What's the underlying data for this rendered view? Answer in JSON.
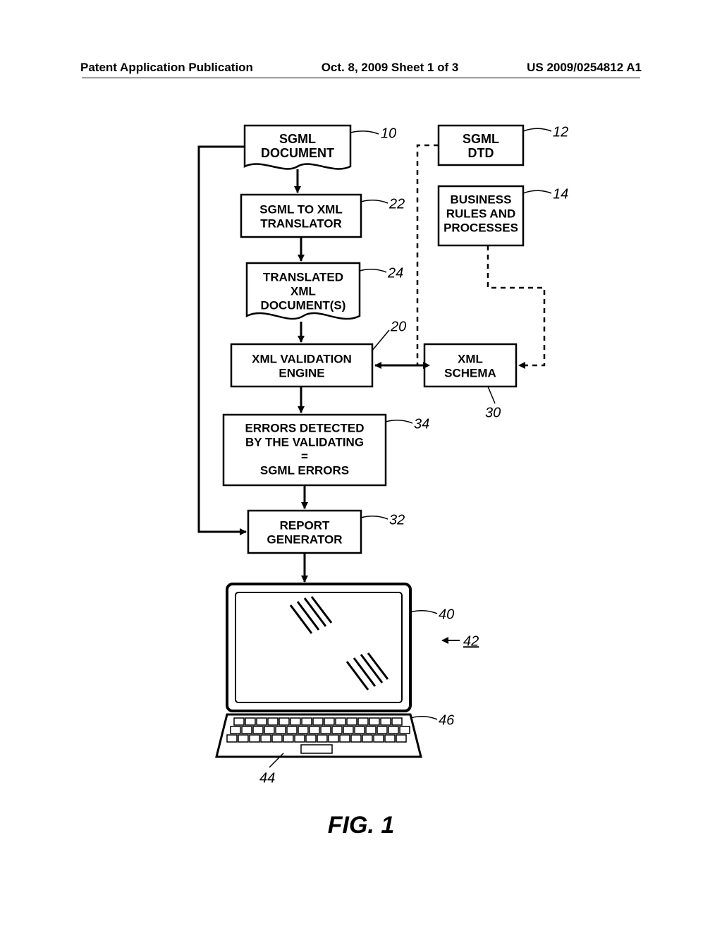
{
  "header": {
    "left": "Patent Application Publication",
    "center": "Oct. 8, 2009  Sheet 1 of 3",
    "right": "US 2009/0254812 A1"
  },
  "figure_label": "FIG. 1",
  "boxes": {
    "sgml_doc": "SGML\nDOCUMENT",
    "sgml_dtd": "SGML\nDTD",
    "business": "BUSINESS\nRULES AND\nPROCESSES",
    "translator": "SGML TO XML\nTRANSLATOR",
    "translated": "TRANSLATED\nXML\nDOCUMENT(S)",
    "validation": "XML VALIDATION\nENGINE",
    "schema": "XML\nSCHEMA",
    "errors": "ERRORS DETECTED\nBY THE VALIDATING\n=\nSGML ERRORS",
    "report": "REPORT\nGENERATOR"
  },
  "refs": {
    "r10": "10",
    "r12": "12",
    "r14": "14",
    "r22": "22",
    "r24": "24",
    "r20": "20",
    "r30": "30",
    "r34": "34",
    "r32": "32",
    "r40": "40",
    "r42": "42",
    "r44": "44",
    "r46": "46"
  }
}
